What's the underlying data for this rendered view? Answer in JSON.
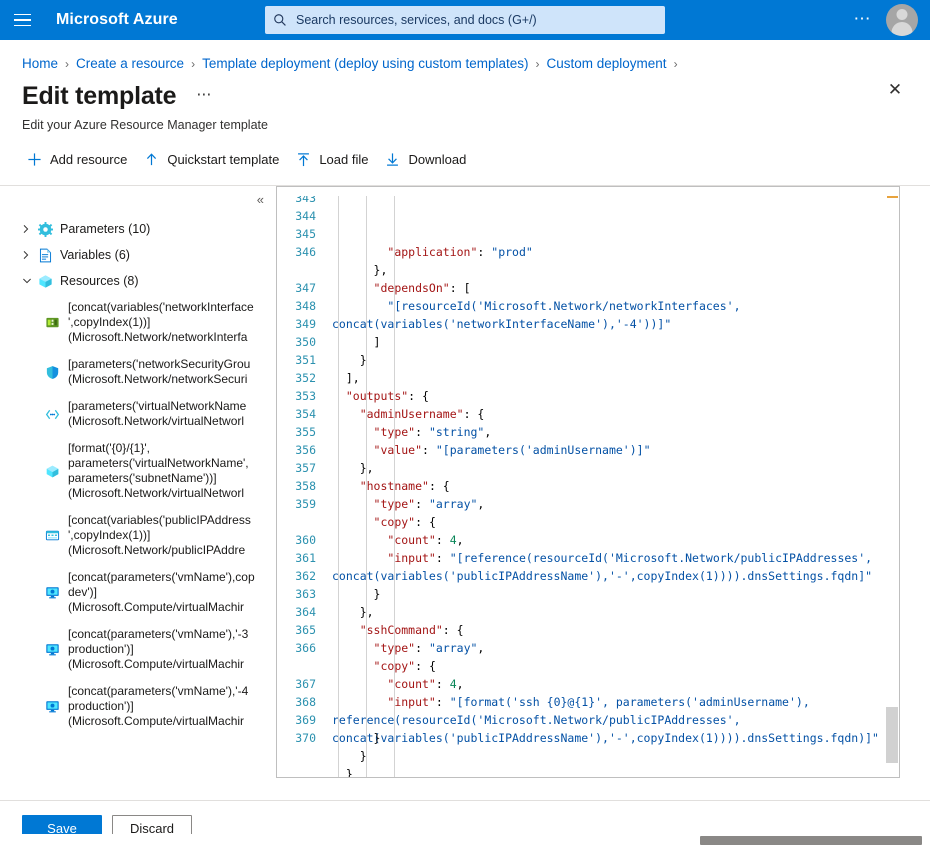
{
  "topbar": {
    "menu_icon": "hamburger-icon",
    "brand": "Microsoft Azure",
    "search_placeholder": "Search resources, services, and docs (G+/)",
    "search_value": "",
    "search_icon": "search-icon",
    "more_label": "⋯",
    "avatar_icon": "account-avatar"
  },
  "breadcrumb": {
    "items": [
      "Home",
      "Create a resource",
      "Template deployment (deploy using custom templates)",
      "Custom deployment"
    ],
    "separator": "›"
  },
  "header": {
    "title": "Edit template",
    "more_label": "⋯",
    "close_label": "✕",
    "subtitle": "Edit your Azure Resource Manager template"
  },
  "toolbar": {
    "items": [
      {
        "label": "Add resource",
        "icon": "plus-icon"
      },
      {
        "label": "Quickstart template",
        "icon": "arrow-up-icon"
      },
      {
        "label": "Load file",
        "icon": "upload-icon"
      },
      {
        "label": "Download",
        "icon": "download-icon"
      }
    ]
  },
  "tree": {
    "collapse_label": "«",
    "groups": [
      {
        "label": "Parameters (10)",
        "icon": "gear-icon",
        "expanded": false,
        "chevron": "chevron-right"
      },
      {
        "label": "Variables (6)",
        "icon": "document-icon",
        "expanded": false,
        "chevron": "chevron-right"
      },
      {
        "label": "Resources (8)",
        "icon": "cube-icon",
        "expanded": true,
        "chevron": "chevron-down"
      }
    ],
    "resources": [
      {
        "icon": "network-interface-icon",
        "line1": "[concat(variables('networkInterface",
        "line2": "',copyIndex(1))]",
        "line3": "(Microsoft.Network/networkInterfa"
      },
      {
        "icon": "shield-icon",
        "line1": "[parameters('networkSecurityGrou",
        "line2": "(Microsoft.Network/networkSecuri",
        "line3": ""
      },
      {
        "icon": "virtual-network-icon",
        "line1": "[parameters('virtualNetworkName",
        "line2": "(Microsoft.Network/virtualNetworl",
        "line3": ""
      },
      {
        "icon": "subnet-icon",
        "line1": "[format('{0}/{1}',",
        "line2": "parameters('virtualNetworkName',",
        "line3": "parameters('subnetName'))]",
        "line4": "(Microsoft.Network/virtualNetworl"
      },
      {
        "icon": "public-ip-icon",
        "line1": "[concat(variables('publicIPAddress",
        "line2": "',copyIndex(1))]",
        "line3": "(Microsoft.Network/publicIPAddre"
      },
      {
        "icon": "virtual-machine-icon",
        "line1": "[concat(parameters('vmName'),cop",
        "line2": "dev')]",
        "line3": "(Microsoft.Compute/virtualMachir"
      },
      {
        "icon": "virtual-machine-icon",
        "line1": "[concat(parameters('vmName'),'-3",
        "line2": "production')]",
        "line3": "(Microsoft.Compute/virtualMachir"
      },
      {
        "icon": "virtual-machine-icon",
        "line1": "[concat(parameters('vmName'),'-4",
        "line2": "production')]",
        "line3": "(Microsoft.Compute/virtualMachir"
      }
    ]
  },
  "editor": {
    "first_line_number": 343,
    "last_line_number": 370,
    "line_numbers": [
      343,
      344,
      345,
      346,
      347,
      348,
      349,
      350,
      351,
      352,
      353,
      354,
      355,
      356,
      357,
      358,
      359,
      360,
      361,
      362,
      363,
      364,
      365,
      366,
      367,
      368,
      369,
      370
    ],
    "lines": [
      {
        "num": 343,
        "clipped": true,
        "segments": [
          {
            "t": "        ",
            "c": "p"
          },
          {
            "t": "\"application\"",
            "c": "k"
          },
          {
            "t": ": ",
            "c": "p"
          },
          {
            "t": "\"prod\"",
            "c": "s"
          }
        ]
      },
      {
        "num": 344,
        "segments": [
          {
            "t": "      },",
            "c": "p"
          }
        ]
      },
      {
        "num": 345,
        "segments": [
          {
            "t": "      ",
            "c": "p"
          },
          {
            "t": "\"dependsOn\"",
            "c": "k"
          },
          {
            "t": ": [",
            "c": "p"
          }
        ]
      },
      {
        "num": 346,
        "wrapped": true,
        "segments": [
          {
            "t": "        ",
            "c": "p"
          },
          {
            "t": "\"[resourceId('Microsoft.Network/networkInterfaces', concat(variables('networkInterfaceName'),'-4'))]\"",
            "c": "s"
          }
        ]
      },
      {
        "num": 347,
        "segments": [
          {
            "t": "      ]",
            "c": "p"
          }
        ]
      },
      {
        "num": 348,
        "segments": [
          {
            "t": "    }",
            "c": "p"
          }
        ]
      },
      {
        "num": 349,
        "segments": [
          {
            "t": "  ],",
            "c": "p"
          }
        ]
      },
      {
        "num": 350,
        "segments": [
          {
            "t": "  ",
            "c": "p"
          },
          {
            "t": "\"outputs\"",
            "c": "k"
          },
          {
            "t": ": {",
            "c": "p"
          }
        ]
      },
      {
        "num": 351,
        "segments": [
          {
            "t": "    ",
            "c": "p"
          },
          {
            "t": "\"adminUsername\"",
            "c": "k"
          },
          {
            "t": ": {",
            "c": "p"
          }
        ]
      },
      {
        "num": 352,
        "segments": [
          {
            "t": "      ",
            "c": "p"
          },
          {
            "t": "\"type\"",
            "c": "k"
          },
          {
            "t": ": ",
            "c": "p"
          },
          {
            "t": "\"string\"",
            "c": "s"
          },
          {
            "t": ",",
            "c": "p"
          }
        ]
      },
      {
        "num": 353,
        "segments": [
          {
            "t": "      ",
            "c": "p"
          },
          {
            "t": "\"value\"",
            "c": "k"
          },
          {
            "t": ": ",
            "c": "p"
          },
          {
            "t": "\"[parameters('adminUsername')]\"",
            "c": "s"
          }
        ]
      },
      {
        "num": 354,
        "segments": [
          {
            "t": "    },",
            "c": "p"
          }
        ]
      },
      {
        "num": 355,
        "segments": [
          {
            "t": "    ",
            "c": "p"
          },
          {
            "t": "\"hostname\"",
            "c": "k"
          },
          {
            "t": ": {",
            "c": "p"
          }
        ]
      },
      {
        "num": 356,
        "segments": [
          {
            "t": "      ",
            "c": "p"
          },
          {
            "t": "\"type\"",
            "c": "k"
          },
          {
            "t": ": ",
            "c": "p"
          },
          {
            "t": "\"array\"",
            "c": "s"
          },
          {
            "t": ",",
            "c": "p"
          }
        ]
      },
      {
        "num": 357,
        "segments": [
          {
            "t": "      ",
            "c": "p"
          },
          {
            "t": "\"copy\"",
            "c": "k"
          },
          {
            "t": ": {",
            "c": "p"
          }
        ]
      },
      {
        "num": 358,
        "segments": [
          {
            "t": "        ",
            "c": "p"
          },
          {
            "t": "\"count\"",
            "c": "k"
          },
          {
            "t": ": ",
            "c": "p"
          },
          {
            "t": "4",
            "c": "n"
          },
          {
            "t": ",",
            "c": "p"
          }
        ]
      },
      {
        "num": 359,
        "wrapped": true,
        "segments": [
          {
            "t": "        ",
            "c": "p"
          },
          {
            "t": "\"input\"",
            "c": "k"
          },
          {
            "t": ": ",
            "c": "p"
          },
          {
            "t": "\"[reference(resourceId('Microsoft.Network/publicIPAddresses', concat(variables('publicIPAddressName'),'-',copyIndex(1)))).dnsSettings.fqdn]\"",
            "c": "s"
          }
        ]
      },
      {
        "num": 360,
        "segments": [
          {
            "t": "      }",
            "c": "p"
          }
        ]
      },
      {
        "num": 361,
        "segments": [
          {
            "t": "    },",
            "c": "p"
          }
        ]
      },
      {
        "num": 362,
        "segments": [
          {
            "t": "    ",
            "c": "p"
          },
          {
            "t": "\"sshCommand\"",
            "c": "k"
          },
          {
            "t": ": {",
            "c": "p"
          }
        ]
      },
      {
        "num": 363,
        "segments": [
          {
            "t": "      ",
            "c": "p"
          },
          {
            "t": "\"type\"",
            "c": "k"
          },
          {
            "t": ": ",
            "c": "p"
          },
          {
            "t": "\"array\"",
            "c": "s"
          },
          {
            "t": ",",
            "c": "p"
          }
        ]
      },
      {
        "num": 364,
        "segments": [
          {
            "t": "      ",
            "c": "p"
          },
          {
            "t": "\"copy\"",
            "c": "k"
          },
          {
            "t": ": {",
            "c": "p"
          }
        ]
      },
      {
        "num": 365,
        "segments": [
          {
            "t": "        ",
            "c": "p"
          },
          {
            "t": "\"count\"",
            "c": "k"
          },
          {
            "t": ": ",
            "c": "p"
          },
          {
            "t": "4",
            "c": "n"
          },
          {
            "t": ",",
            "c": "p"
          }
        ]
      },
      {
        "num": 366,
        "wrapped": true,
        "segments": [
          {
            "t": "        ",
            "c": "p"
          },
          {
            "t": "\"input\"",
            "c": "k"
          },
          {
            "t": ": ",
            "c": "p"
          },
          {
            "t": "\"[format('ssh {0}@{1}', parameters('adminUsername'), reference(resourceId('Microsoft.Network/publicIPAddresses', concat(variables('publicIPAddressName'),'-',copyIndex(1)))).dnsSettings.fqdn)]\"",
            "c": "s"
          }
        ]
      },
      {
        "num": 367,
        "segments": [
          {
            "t": "      }",
            "c": "p"
          }
        ]
      },
      {
        "num": 368,
        "segments": [
          {
            "t": "    }",
            "c": "p"
          }
        ]
      },
      {
        "num": 369,
        "segments": [
          {
            "t": "  }",
            "c": "p"
          }
        ]
      },
      {
        "num": 370,
        "segments": [
          {
            "t": "}",
            "c": "p"
          }
        ]
      }
    ]
  },
  "footer": {
    "save_label": "Save",
    "discard_label": "Discard"
  },
  "colors": {
    "azure_blue": "#0078d4",
    "link_blue": "#0066cc",
    "search_bg": "#cfe4fa",
    "key_red": "#a31515",
    "string_blue": "#0451a5",
    "number_green": "#098658",
    "line_number_teal": "#2b91af",
    "marker_orange": "#e8a33d"
  }
}
